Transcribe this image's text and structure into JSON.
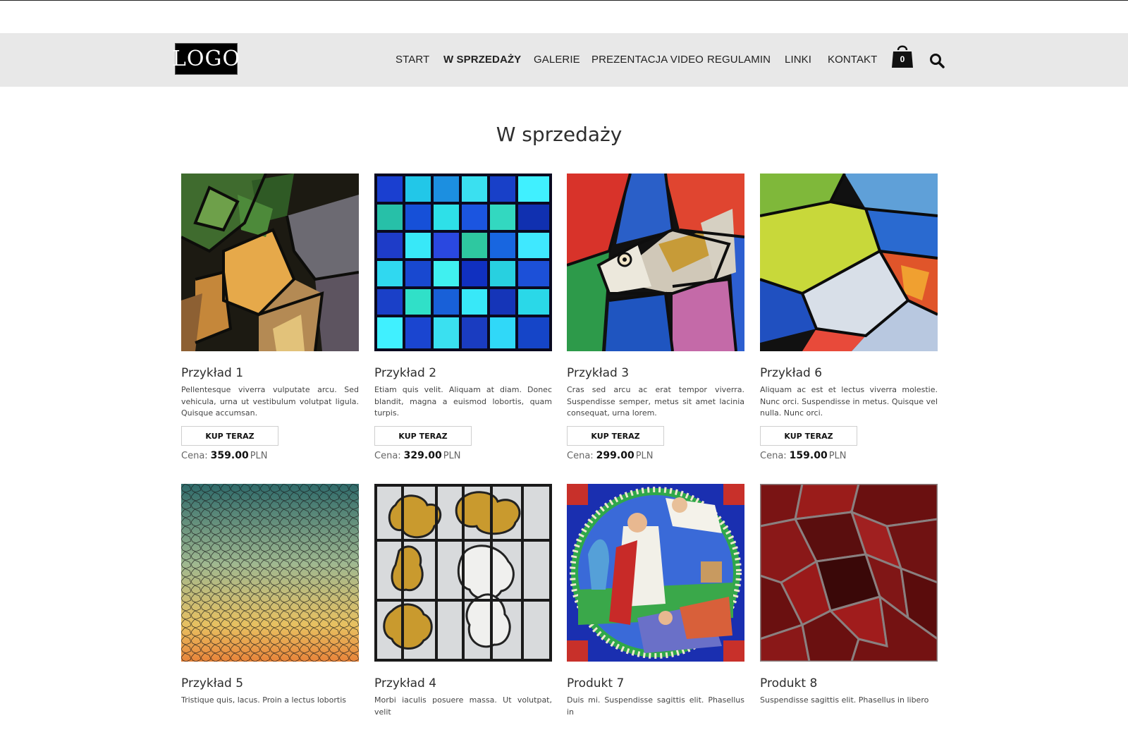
{
  "header": {
    "logo_text": "LOGO",
    "nav": [
      {
        "label": "START",
        "active": false
      },
      {
        "label": "W SPRZEDAŻY",
        "active": true
      },
      {
        "label": "GALERIE",
        "active": false
      },
      {
        "label": "PREZENTACJA VIDEO",
        "active": false
      },
      {
        "label": "REGULAMIN",
        "active": false
      },
      {
        "label": "LINKI",
        "active": false
      },
      {
        "label": "KONTAKT",
        "active": false
      }
    ],
    "cart_icon": "shopping-bag-icon",
    "cart_count": "0",
    "search_icon": "search-icon"
  },
  "main": {
    "title": "W sprzedaży",
    "buy_label": "KUP TERAZ",
    "price_label": "Cena:",
    "currency": "PLN",
    "products": [
      {
        "name": "Przykład 1",
        "description": "Pellentesque viverra vulputate arcu. Sed vehicula, urna ut vestibulum volutpat ligula. Quisque accumsan.",
        "price": "359.00",
        "image": "stained-glass-leaves"
      },
      {
        "name": "Przykład 2",
        "description": "Etiam quis velit. Aliquam at diam. Donec blandit, magna a euismod lobortis, quam turpis.",
        "price": "329.00",
        "image": "stained-glass-blue-grid"
      },
      {
        "name": "Przykład 3",
        "description": "Cras sed arcu ac erat tempor viverra. Suspendisse semper, metus sit amet lacinia consequat, urna lorem.",
        "price": "299.00",
        "image": "stained-glass-fish"
      },
      {
        "name": "Przykład 6",
        "description": "Aliquam ac est et lectus viverra molestie. Nunc orci. Suspendisse in metus. Quisque vel nulla. Nunc orci.",
        "price": "159.00",
        "image": "stained-glass-abstract"
      },
      {
        "name": "Przykład 5",
        "description": "Tristique quis, lacus. Proin a lectus lobortis",
        "price": "",
        "image": "crackle-glass-gradient"
      },
      {
        "name": "Przykład 4",
        "description": "Morbi iaculis posuere massa. Ut volutpat, velit",
        "price": "",
        "image": "stained-glass-clouds"
      },
      {
        "name": "Produkt 7",
        "description": "Duis mi. Suspendisse sagittis elit. Phasellus in",
        "price": "",
        "image": "stained-glass-religious-scene"
      },
      {
        "name": "Produkt 8",
        "description": "Suspendisse sagittis elit. Phasellus in libero",
        "price": "",
        "image": "stained-glass-red-cells"
      }
    ]
  },
  "colors": {
    "header_bg": "#e8e8e8",
    "text": "#2a2a2a",
    "button_border": "#cfcfcf"
  }
}
